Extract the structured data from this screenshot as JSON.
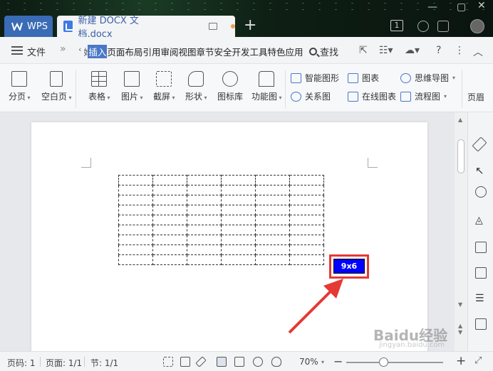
{
  "titlebar": {
    "app_tab": "WPS",
    "doc_tab": "新建 DOCX 文档.docx",
    "new_tab": "+",
    "window_count": "1"
  },
  "menu": {
    "file": "文件",
    "more": "»",
    "prev": "‹",
    "items": [
      "插入",
      "页面布局",
      "引用",
      "审阅",
      "视图",
      "章节",
      "安全",
      "开发工具",
      "特色应用"
    ],
    "active": "插入",
    "search": "查找"
  },
  "ribbon": {
    "page_break": "分页",
    "blank_page": "空白页",
    "table": "表格",
    "picture": "图片",
    "screenshot": "截屏",
    "shape": "形状",
    "icon_lib": "图标库",
    "func_chart": "功能图",
    "smart_graphic": "智能图形",
    "chart": "图表",
    "mind_map": "思维导图",
    "relation_chart": "关系图",
    "online_chart": "在线图表",
    "flowchart": "流程图",
    "header_cut": "页眉"
  },
  "document": {
    "grid_size_label": "9x6",
    "rows": 9,
    "cols": 6
  },
  "statusbar": {
    "page_num": "页码: 1",
    "pages": "页面: 1/1",
    "section": "节: 1/1",
    "zoom": "70%"
  },
  "watermark": {
    "text": "Baidu经验",
    "sub": "jingyan.baidu.com"
  },
  "colors": {
    "accent": "#4a78c8",
    "highlight_box": "#e53935",
    "grid_tip": "#0000ff"
  }
}
